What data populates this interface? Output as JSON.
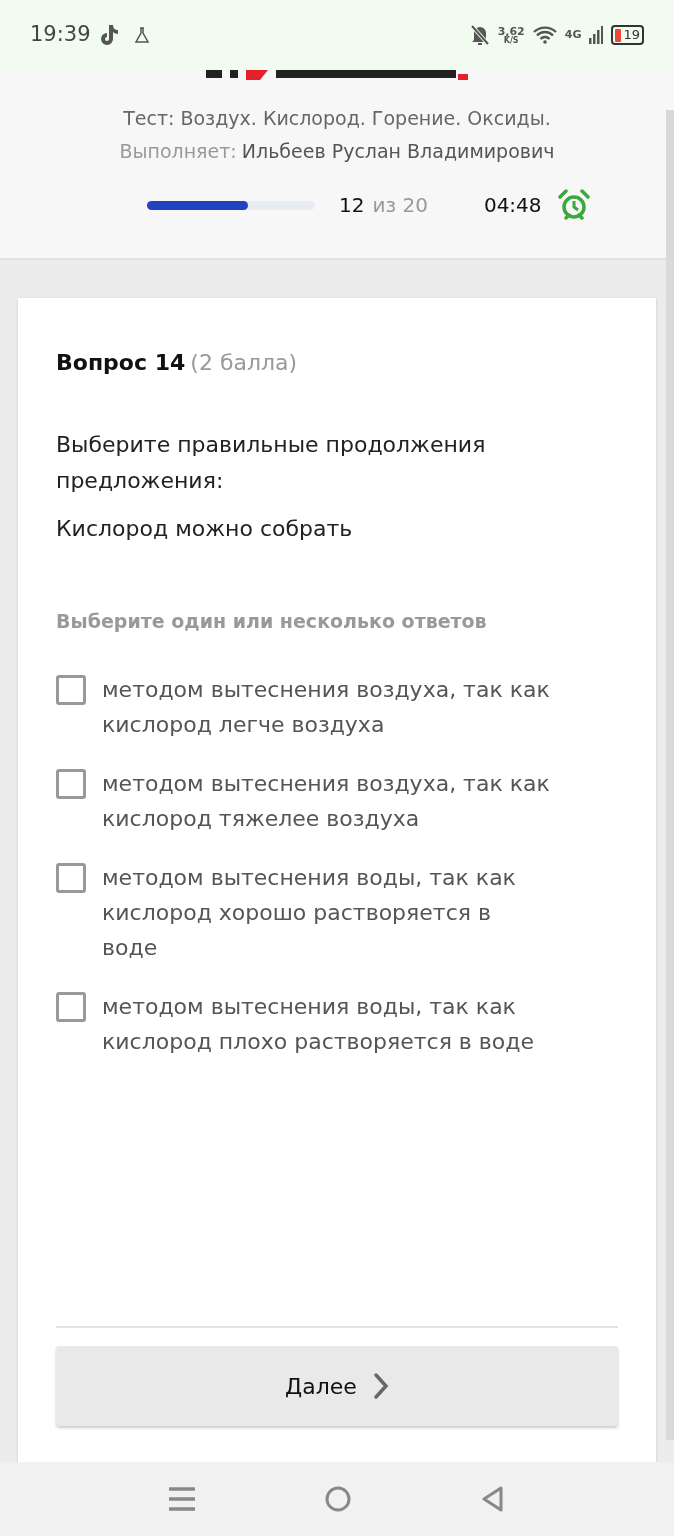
{
  "status_bar": {
    "time": "19:39",
    "net_speed": "3,62",
    "net_unit": "K/S",
    "network": "4G",
    "battery": "19"
  },
  "header": {
    "test_title": "Тест: Воздух. Кислород. Горение. Оксиды.",
    "performer_label": "Выполняет:",
    "performer_name": "Ильбеев Руслан Владимирович",
    "progress": {
      "level": 0.6,
      "current": "12",
      "total": "из 20"
    },
    "timer": "04:48"
  },
  "question": {
    "title": "Вопрос 14",
    "points": "(2 балла)",
    "text": [
      "Выберите правильные продолжения предложения:",
      "Кислород можно собрать"
    ],
    "hint": "Выберите один или несколько ответов",
    "options": [
      {
        "label": "методом вытеснения воздуха, так как кислород легче воздуха",
        "checked": false
      },
      {
        "label": "методом вытеснения воздуха, так как кислород тяжелее воздуха",
        "checked": false
      },
      {
        "label": "методом вытеснения воды, так как кислород хорошо растворяется в воде",
        "checked": false
      },
      {
        "label": "методом вытеснения воды, так как кислород плохо растворяется в воде",
        "checked": false
      }
    ]
  },
  "next_button": "Далее"
}
